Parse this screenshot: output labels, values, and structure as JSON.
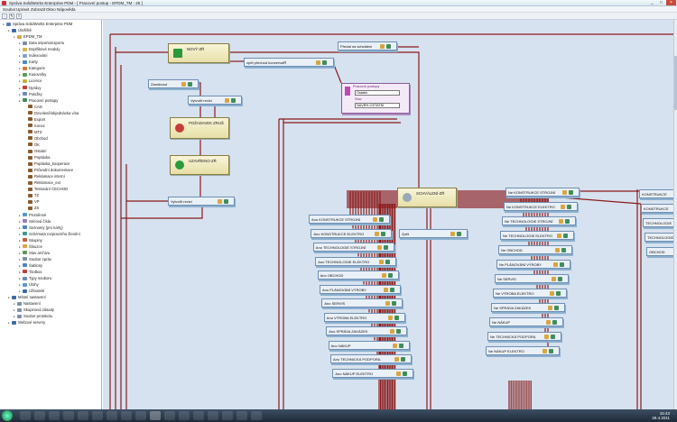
{
  "window": {
    "title": "Správa SolidWorks Enterprise PDM - [ Pracovní postup - EPDM_TM - 25 ]",
    "controls": [
      "_",
      "□",
      "×"
    ]
  },
  "menu": [
    "Soubor",
    "Upravit",
    "Zobrazit",
    "Okno",
    "Nápověda"
  ],
  "tree": {
    "items": [
      {
        "label": "Správa SolidWorks Enterprise PDM",
        "level": 0,
        "color": "#5a7fb0"
      },
      {
        "label": "Úložiště",
        "level": 1,
        "color": "#3b6aa8"
      },
      {
        "label": "EPDM_TM",
        "level": 2,
        "color": "#d8a640"
      },
      {
        "label": "Data importu/exportu",
        "level": 3,
        "color": "#7d8fa8"
      },
      {
        "label": "Doplňkové moduly",
        "level": 3,
        "color": "#d9b54a"
      },
      {
        "label": "Indexování",
        "level": 3,
        "color": "#7da4c9"
      },
      {
        "label": "Karty",
        "level": 3,
        "color": "#4a86c8"
      },
      {
        "label": "Kategorie",
        "level": 3,
        "color": "#d27a3a"
      },
      {
        "label": "Kusovníky",
        "level": 3,
        "color": "#5d9a5a"
      },
      {
        "label": "Licence",
        "level": 3,
        "color": "#c7b03a"
      },
      {
        "label": "Oprávy",
        "level": 3,
        "color": "#c83b3b"
      },
      {
        "label": "Položky",
        "level": 3,
        "color": "#6a8ab8"
      },
      {
        "label": "Pracovní postupy",
        "level": 3,
        "color": "#3e8e5a"
      },
      {
        "label": "CAD",
        "level": 4,
        "color": "#8d5a2a"
      },
      {
        "label": "Dovoleně/objednávka vína",
        "level": 4,
        "color": "#8d5a2a"
      },
      {
        "label": "Export",
        "level": 4,
        "color": "#8d5a2a"
      },
      {
        "label": "Konec",
        "level": 4,
        "color": "#8d5a2a"
      },
      {
        "label": "MTZ",
        "level": 4,
        "color": "#8d5a2a"
      },
      {
        "label": "Obchod",
        "level": 4,
        "color": "#8d5a2a"
      },
      {
        "label": "OK",
        "level": 4,
        "color": "#8d5a2a"
      },
      {
        "label": "Ostatní",
        "level": 4,
        "color": "#8d5a2a"
      },
      {
        "label": "Poptávka",
        "level": 4,
        "color": "#8d5a2a"
      },
      {
        "label": "Poptávka_kooperace",
        "level": 4,
        "color": "#8d5a2a"
      },
      {
        "label": "Průvodní dokumentace",
        "level": 4,
        "color": "#8d5a2a"
      },
      {
        "label": "Reklamace interní",
        "level": 4,
        "color": "#8d5a2a"
      },
      {
        "label": "Reklamace_ext",
        "level": 4,
        "color": "#8d5a2a"
      },
      {
        "label": "Testování CECHOD",
        "level": 4,
        "color": "#8d5a2a"
      },
      {
        "label": "TZ",
        "level": 4,
        "color": "#8d5a2a"
      },
      {
        "label": "VP",
        "level": 4,
        "color": "#8d5a2a"
      },
      {
        "label": "ZS",
        "level": 4,
        "color": "#8d5a2a"
      },
      {
        "label": "Proměnné",
        "level": 3,
        "color": "#5a9ad0"
      },
      {
        "label": "Sériová čísla",
        "level": 3,
        "color": "#9a7abf"
      },
      {
        "label": "Seznamy (pro karty)",
        "level": 3,
        "color": "#4a86c8"
      },
      {
        "label": "Schémata rozpracního členění",
        "level": 3,
        "color": "#3b9a8a"
      },
      {
        "label": "Skupiny",
        "level": 3,
        "color": "#c85a3a"
      },
      {
        "label": "Šlouzce",
        "level": 3,
        "color": "#d8a640"
      },
      {
        "label": "Stav archivu",
        "level": 3,
        "color": "#5d9a5a"
      },
      {
        "label": "Soubor zpráv",
        "level": 3,
        "color": "#7d8fa8"
      },
      {
        "label": "Šablony",
        "level": 3,
        "color": "#4a86c8"
      },
      {
        "label": "Toolbox",
        "level": 3,
        "color": "#c83b3b"
      },
      {
        "label": "Typy souboru",
        "level": 3,
        "color": "#6a8ab8"
      },
      {
        "label": "Úlohy",
        "level": 3,
        "color": "#5a9ad0"
      },
      {
        "label": "Uživatelé",
        "level": 3,
        "color": "#3e6ab0"
      },
      {
        "label": "Místní nastavení",
        "level": 1,
        "color": "#3b6aa8"
      },
      {
        "label": "Nastavení",
        "level": 2,
        "color": "#7d8fa8"
      },
      {
        "label": "Skupinová zásady",
        "level": 2,
        "color": "#7d8fa8"
      },
      {
        "label": "Soubor protokolu",
        "level": 2,
        "color": "#7d8fa8"
      },
      {
        "label": "Webové servery",
        "level": 1,
        "color": "#3b6aa8"
      }
    ]
  },
  "workflow": {
    "states": [
      {
        "key": "novy",
        "label": "NOVÝ-ZŘ",
        "icon_color": "#2a9a3a"
      },
      {
        "key": "pozadavek",
        "label": "POŽADAVEK ZRUŠ",
        "icon_color": "#c83b3b"
      },
      {
        "key": "uzavreno",
        "label": "UZAVŘENO-ZŘ",
        "icon_color": "#2a9a3a"
      },
      {
        "key": "schvaleni",
        "label": "SCHVÁLENÍ-ZŘ",
        "icon_color": "#9aa8b9"
      }
    ],
    "transitions_top": [
      {
        "key": "predat",
        "label": "Předat na schválení"
      },
      {
        "key": "zpet",
        "label": "zpět přechod konzervalŘ"
      },
      {
        "key": "zamitnout",
        "label": "Zamítnout"
      },
      {
        "key": "vytvorit1",
        "label": "Vytvořit revizi"
      },
      {
        "key": "vytvorit2",
        "label": "Vytvořit revizi"
      },
      {
        "key": "zpet2",
        "label": "Zpět"
      }
    ],
    "dialog": {
      "title": "Pracovní postupy",
      "field1_label": "Ostatní",
      "field2_label": "Stav",
      "field2_value": "NÁVRH-OSTATNÍ"
    },
    "ano_list": [
      "Ano KONSTRUKCE STROJNÍ",
      "Ano KONSTRUKCE ELEKTRO",
      "Ano TECHNOLOGIE STROJNÍ",
      "Ano TECHNOLOGIE ELEKTRO",
      "Ano OBCHOD",
      "Ano PLÁNOVÁNÍ VÝROBY",
      "Ano SERVIS",
      "Ano VÝROBA ELEKTRO",
      "Ano SPRÁVA ZAKÁZEK",
      "Ano NÁKUP",
      "Ano TECHNICKÁ PODPORA",
      "Ano NÁKUP ELEKTRO"
    ],
    "ne_list": [
      "Ne KONSTRUKCE STROJNÍ",
      "Ne KONSTRUKCE ELEKTRO",
      "Ne TECHNOLOGIE STROJNÍ",
      "Ne TECHNOLOGIE ELEKTRO",
      "Ne OBCHOD",
      "Ne PLÁNOVÁNÍ VÝROBY",
      "Ne SERVIS",
      "Ne VÝROBA ELEKTRO",
      "Ne SPRÁVA ZAKÁZEK",
      "Ne NÁKUP",
      "Ne TECHNICKÁ PODPORA",
      "Ne NÁKUP ELEKTRO"
    ],
    "right_cut": [
      "KONSTRUKCE",
      "KONSTRUKCE",
      "TECHNOLOGIE",
      "TECHNOLOGIE",
      "OBCHOD"
    ]
  },
  "taskbar": {
    "time": "15:43",
    "date": "28.4.2011"
  },
  "colors": {
    "line": "#8b1a1a",
    "canvas": "#d6e2ef",
    "state_fill": "#ece4b0"
  }
}
